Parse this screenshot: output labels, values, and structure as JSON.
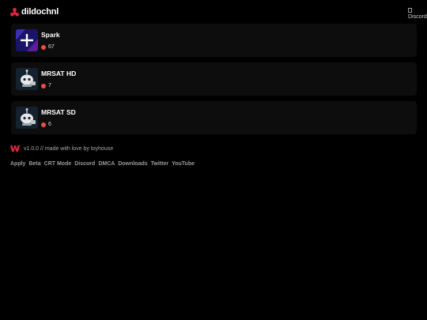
{
  "header": {
    "logo_text": "dildochnl",
    "logo_icon": "tri-dot-logo-icon",
    "discord_alt": "Discord"
  },
  "channels": [
    {
      "name": "Spark",
      "viewers": "67",
      "thumb": "spark-plus-icon"
    },
    {
      "name": "MRSAT HD",
      "viewers": "7",
      "thumb": "robot-cat-icon"
    },
    {
      "name": "MRSAT SD",
      "viewers": "6",
      "thumb": "robot-cat-icon"
    }
  ],
  "footer": {
    "credit": "v1.0.0 // made with love by toyhouse",
    "links": [
      "Apply",
      "Beta",
      "CRT Mode",
      "Discord",
      "DMCA",
      "Downloads",
      "Twitter",
      "YouTube"
    ]
  },
  "colors": {
    "background": "#000000",
    "card": "#0d0d0d",
    "accent": "#e0263c",
    "live": "#ec4c4c",
    "link": "#9a9a9a"
  }
}
